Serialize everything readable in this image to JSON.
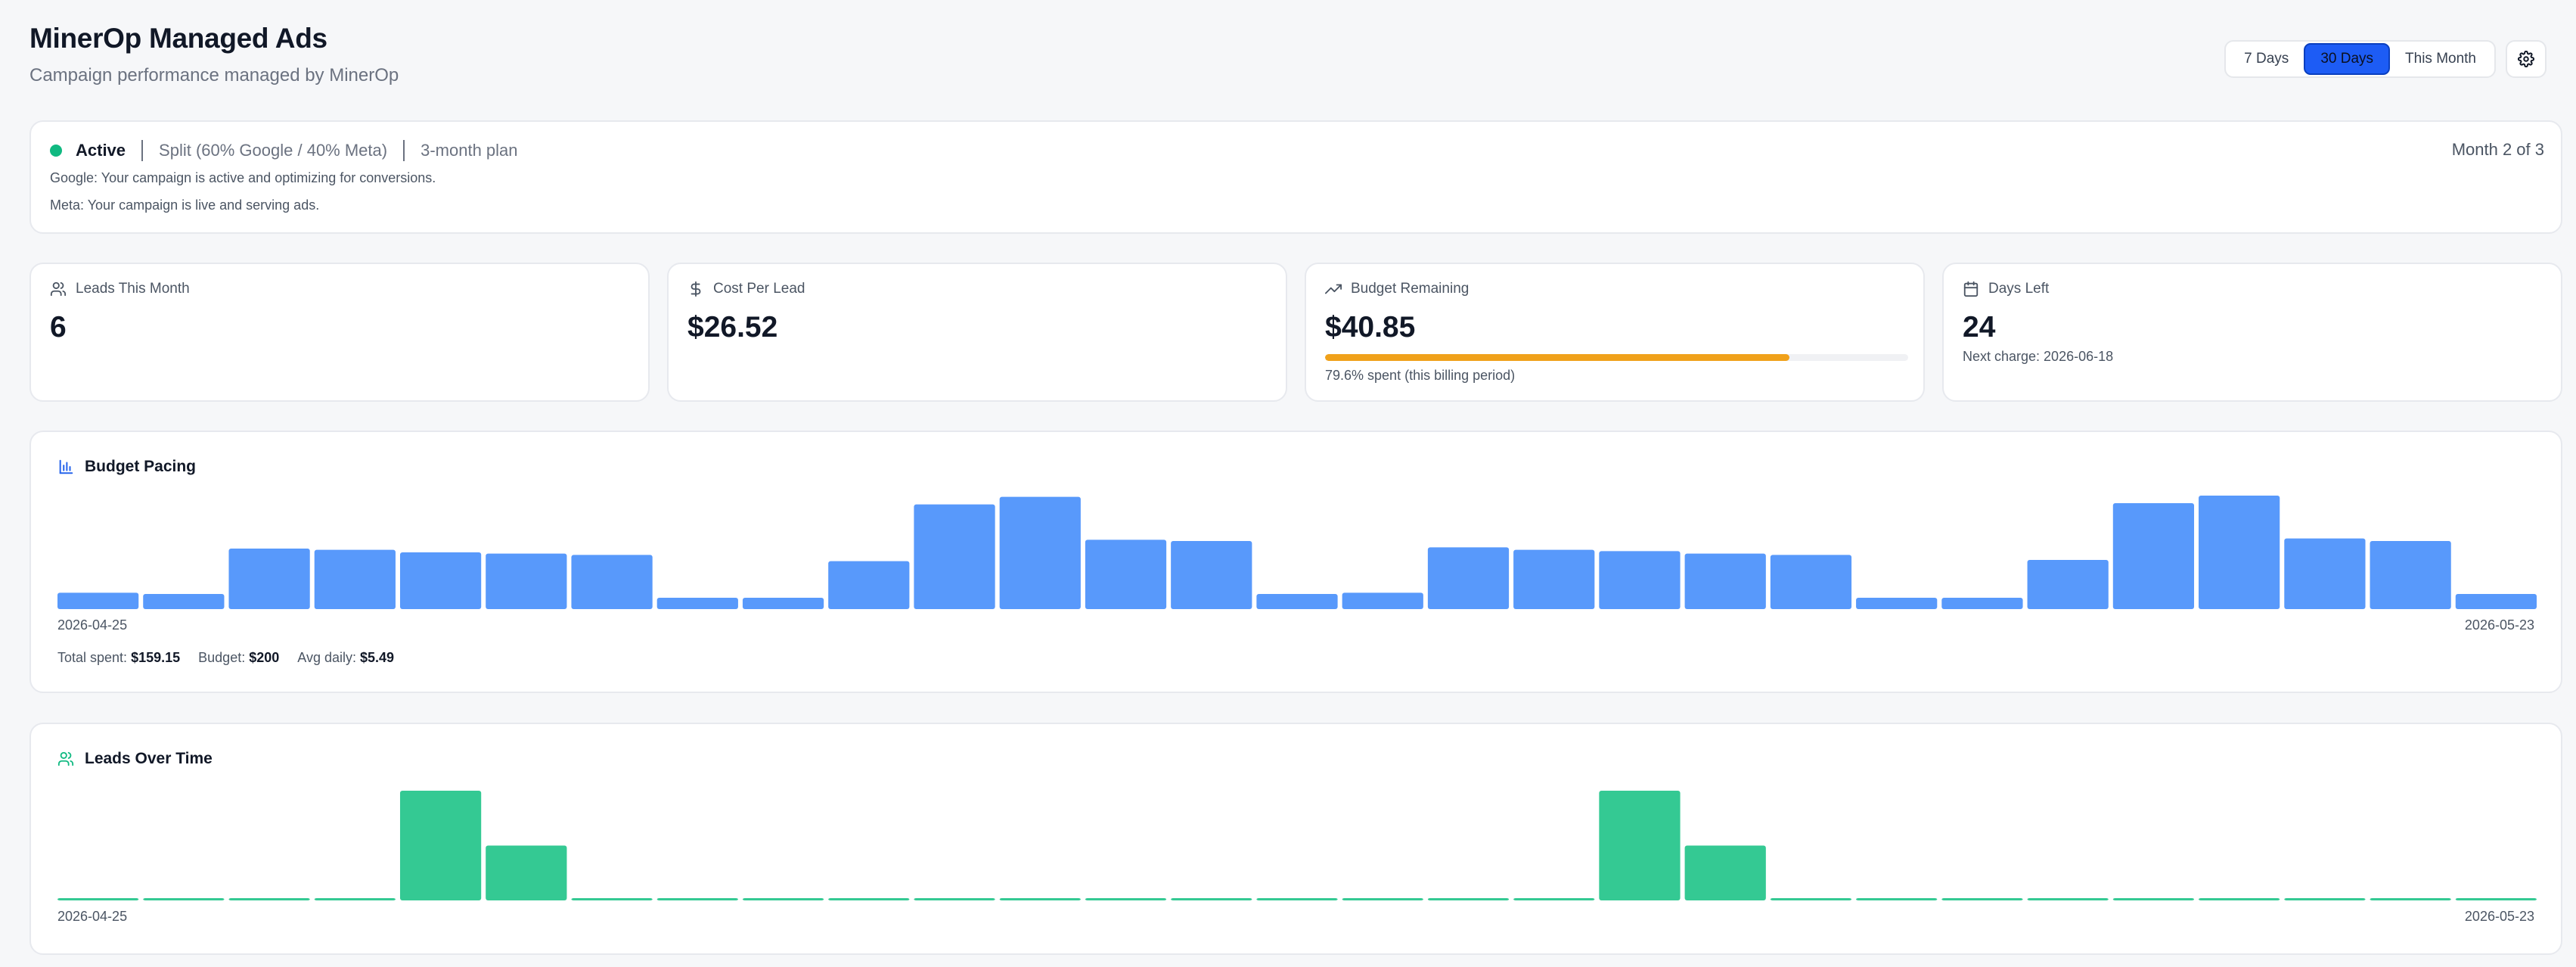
{
  "header": {
    "title": "MinerOp Managed Ads",
    "subtitle": "Campaign performance managed by MinerOp"
  },
  "range": {
    "options": [
      "7 Days",
      "30 Days",
      "This Month"
    ],
    "active": "30 Days"
  },
  "status": {
    "state": "Active",
    "split": "Split (60% Google / 40% Meta)",
    "plan": "3-month plan",
    "google_msg": "Google: Your campaign is active and optimizing for conversions.",
    "meta_msg": "Meta: Your campaign is live and serving ads.",
    "month": "Month 2 of 3"
  },
  "kpis": {
    "leads": {
      "label": "Leads This Month",
      "value": "6",
      "icon": "users-icon"
    },
    "cpl": {
      "label": "Cost Per Lead",
      "value": "$26.52",
      "icon": "dollar-icon"
    },
    "budget": {
      "label": "Budget Remaining",
      "value": "$40.85",
      "spent_fraction": 0.796,
      "note": "79.6% spent (this billing period)",
      "icon": "trending-up-icon"
    },
    "days": {
      "label": "Days Left",
      "value": "24",
      "note": "Next charge: 2026-06-18",
      "icon": "calendar-icon"
    }
  },
  "budget_pacing": {
    "title": "Budget Pacing",
    "start_label": "2026-04-25",
    "end_label": "2026-05-23",
    "totals": {
      "spent_label": "Total spent:",
      "spent": "$159.15",
      "budget_label": "Budget:",
      "budget": "$200",
      "avg_label": "Avg daily:",
      "avg": "$5.49"
    }
  },
  "leads_over_time": {
    "title": "Leads Over Time",
    "start_label": "2026-04-25",
    "end_label": "2026-05-23"
  },
  "colors": {
    "accent": "#1d5cf5",
    "active_dot": "#10b981",
    "budget_bar": "#5899fb",
    "leads_bar": "#34c993",
    "progress": "#f0a11a"
  },
  "chart_data": [
    {
      "type": "bar",
      "title": "Budget Pacing",
      "x_start": "2026-04-25",
      "x_end": "2026-05-23",
      "values": [
        1.3,
        1.2,
        4.8,
        4.7,
        4.5,
        4.4,
        4.3,
        0.9,
        0.9,
        3.8,
        8.3,
        8.9,
        5.5,
        5.4,
        1.2,
        1.3,
        4.9,
        4.7,
        4.6,
        4.4,
        4.3,
        0.9,
        0.9,
        3.9,
        8.4,
        9.0,
        5.6,
        5.4,
        1.2
      ],
      "ylim": [
        0,
        9
      ],
      "grid": false
    },
    {
      "type": "bar",
      "title": "Leads Over Time",
      "x_start": "2026-04-25",
      "x_end": "2026-05-23",
      "values": [
        0,
        0,
        0,
        0,
        2,
        1,
        0,
        0,
        0,
        0,
        0,
        0,
        0,
        0,
        0,
        0,
        0,
        0,
        2,
        1,
        0,
        0,
        0,
        0,
        0,
        0,
        0,
        0,
        0
      ],
      "ylim": [
        0,
        2
      ],
      "grid": false
    }
  ]
}
